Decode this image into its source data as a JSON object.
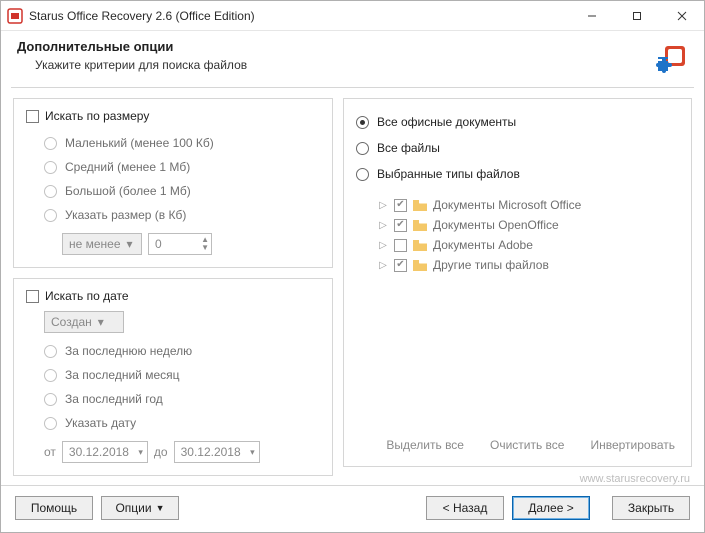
{
  "title": "Starus Office Recovery 2.6 (Office Edition)",
  "header": {
    "title": "Дополнительные опции",
    "subtitle": "Укажите критерии для поиска файлов"
  },
  "size": {
    "section_label": "Искать по размеру",
    "opts": {
      "small": "Маленький (менее 100 Кб)",
      "medium": "Средний (менее 1 Мб)",
      "large": "Большой (более 1 Мб)",
      "custom": "Указать размер (в Кб)"
    },
    "combo": "не менее",
    "value": "0"
  },
  "date": {
    "section_label": "Искать по дате",
    "combo": "Создан",
    "opts": {
      "week": "За последнюю неделю",
      "month": "За последний месяц",
      "year": "За последний год",
      "custom": "Указать дату"
    },
    "from_label": "от",
    "from_value": "30.12.2018",
    "to_label": "до",
    "to_value": "30.12.2018"
  },
  "types": {
    "all_office": "Все офисные документы",
    "all_files": "Все файлы",
    "selected": "Выбранные типы файлов",
    "items": [
      {
        "label": "Документы Microsoft Office",
        "checked": true
      },
      {
        "label": "Документы OpenOffice",
        "checked": true
      },
      {
        "label": "Документы Adobe",
        "checked": false
      },
      {
        "label": "Другие типы файлов",
        "checked": true
      }
    ],
    "links": {
      "select_all": "Выделить все",
      "clear_all": "Очистить все",
      "invert": "Инвертировать"
    }
  },
  "site": "www.starusrecovery.ru",
  "footer": {
    "help": "Помощь",
    "options": "Опции",
    "back": "< Назад",
    "next": "Далее >",
    "close": "Закрыть"
  }
}
